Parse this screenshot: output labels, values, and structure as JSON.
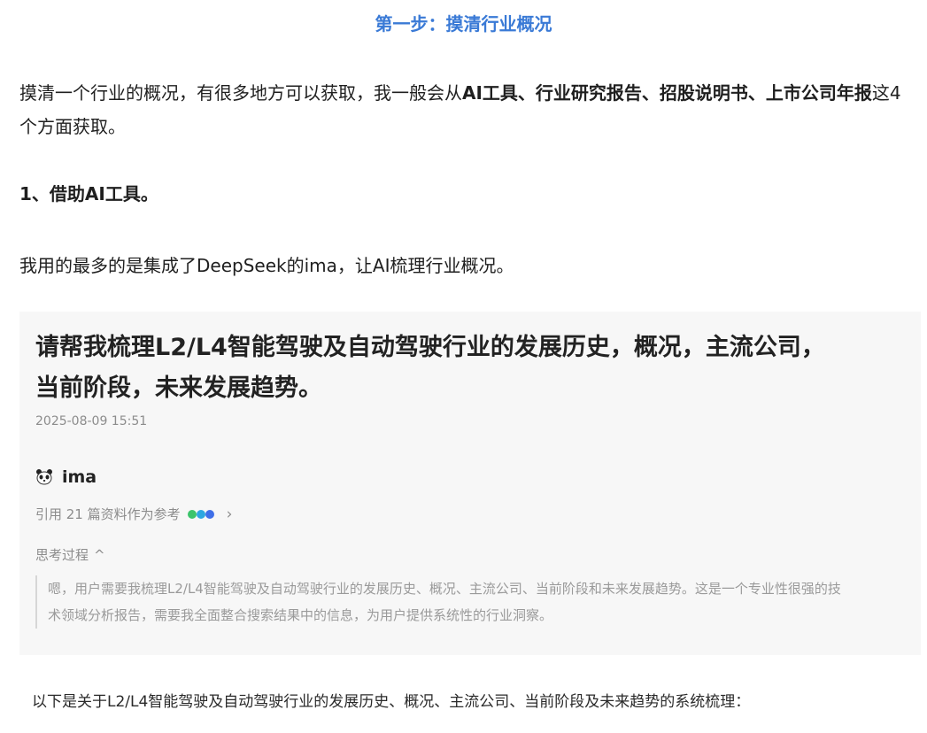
{
  "step_title": "第一步：摸清行业概况",
  "intro": {
    "text_before": "摸清一个行业的概况，有很多地方可以获取，我一般会从",
    "bold_part": "AI工具、行业研究报告、招股说明书、上市公司年报",
    "text_after": "这4个方面获取。"
  },
  "section_heading": "1、借助AI工具。",
  "paragraph2": "我用的最多的是集成了DeepSeek的ima，让AI梳理行业概况。",
  "screenshot": {
    "question": "请帮我梳理L2/L4智能驾驶及自动驾驶行业的发展历史，概况，主流公司，当前阶段，未来发展趋势。",
    "timestamp": "2025-08-09 15:51",
    "assistant_name": "ima",
    "assistant_icon": "panda-icon",
    "citation_text": "引用 21 篇资料作为参考",
    "citation_chevron": "›",
    "source_dot_colors": [
      "#3cc46b",
      "#2ea7e0",
      "#3f6fe8"
    ],
    "thinking_label": "思考过程",
    "thinking_toggle": "^",
    "thinking_text": "嗯，用户需要我梳理L2/L4智能驾驶及自动驾驶行业的发展历史、概况、主流公司、当前阶段和未来发展趋势。这是一个专业性很强的技术领域分析报告，需要我全面整合搜索结果中的信息，为用户提供系统性的行业洞察。"
  },
  "summary_line": "以下是关于L2/L4智能驾驶及自动驾驶行业的发展历史、概况、主流公司、当前阶段及未来趋势的系统梳理："
}
